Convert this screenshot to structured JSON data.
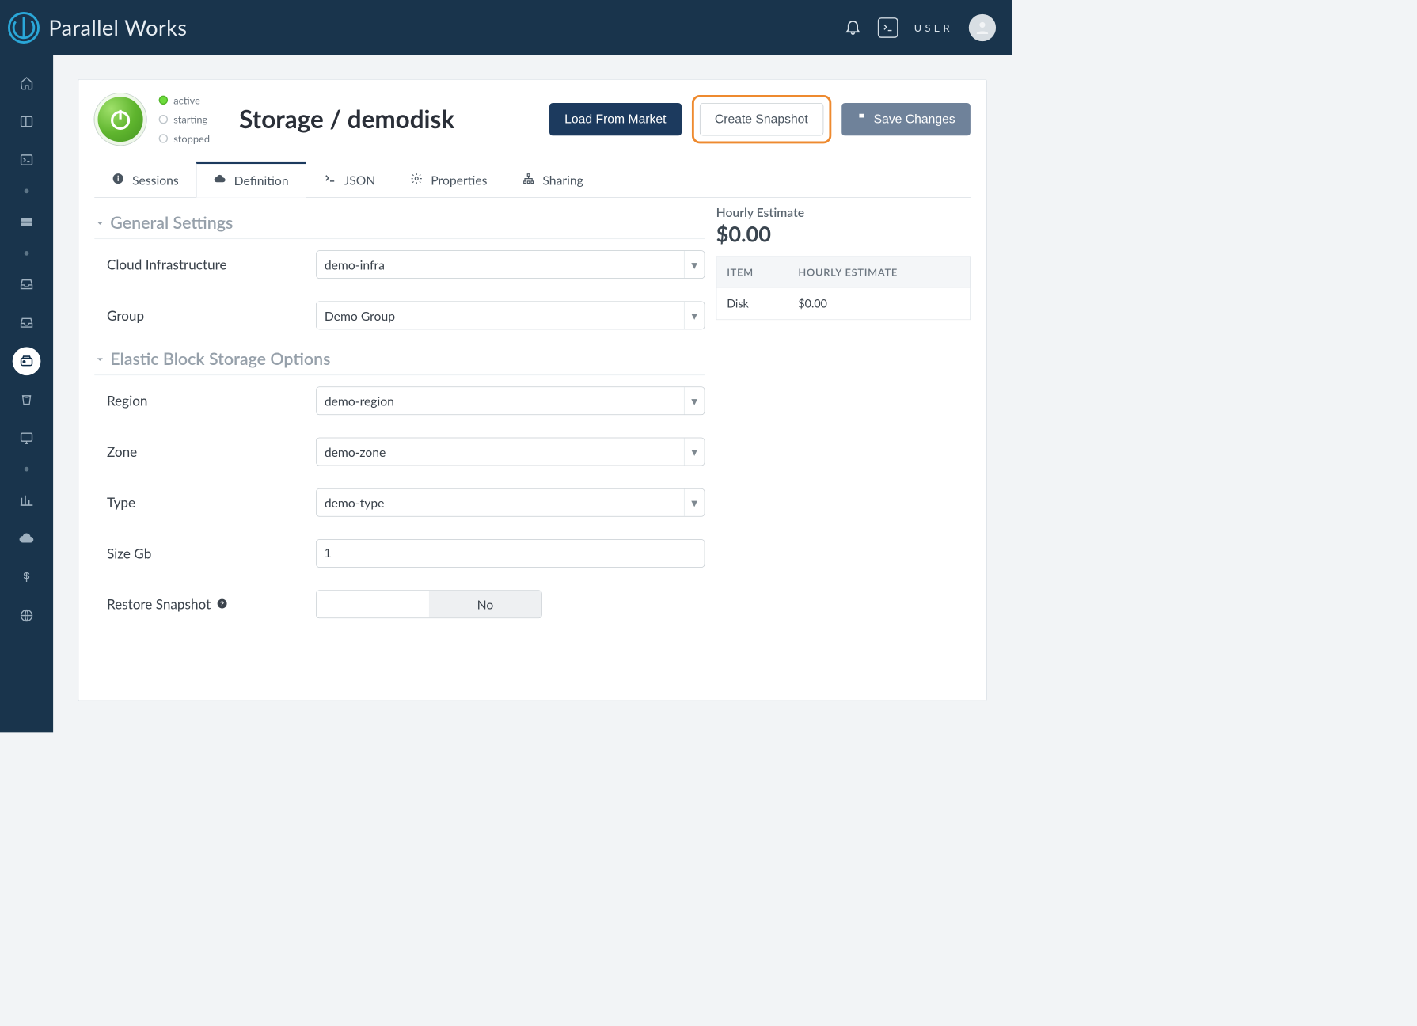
{
  "brand": {
    "name": "Parallel Works"
  },
  "topbar": {
    "user_label": "USER"
  },
  "status": {
    "active": "active",
    "starting": "starting",
    "stopped": "stopped"
  },
  "page": {
    "title": "Storage / demodisk"
  },
  "actions": {
    "load_market": "Load From Market",
    "create_snapshot": "Create Snapshot",
    "save_changes": "Save Changes"
  },
  "tabs": {
    "sessions": "Sessions",
    "definition": "Definition",
    "json": "JSON",
    "properties": "Properties",
    "sharing": "Sharing"
  },
  "sections": {
    "general": "General Settings",
    "ebs": "Elastic Block Storage Options"
  },
  "fields": {
    "cloud_infra": {
      "label": "Cloud Infrastructure",
      "value": "demo-infra"
    },
    "group": {
      "label": "Group",
      "value": "Demo Group"
    },
    "region": {
      "label": "Region",
      "value": "demo-region"
    },
    "zone": {
      "label": "Zone",
      "value": "demo-zone"
    },
    "type": {
      "label": "Type",
      "value": "demo-type"
    },
    "size_gb": {
      "label": "Size Gb",
      "value": "1"
    },
    "restore": {
      "label": "Restore Snapshot",
      "value": "No"
    }
  },
  "estimate": {
    "title": "Hourly Estimate",
    "amount": "$0.00",
    "cols": {
      "item": "ITEM",
      "hourly": "HOURLY ESTIMATE"
    },
    "rows": [
      {
        "item": "Disk",
        "hourly": "$0.00"
      }
    ]
  }
}
